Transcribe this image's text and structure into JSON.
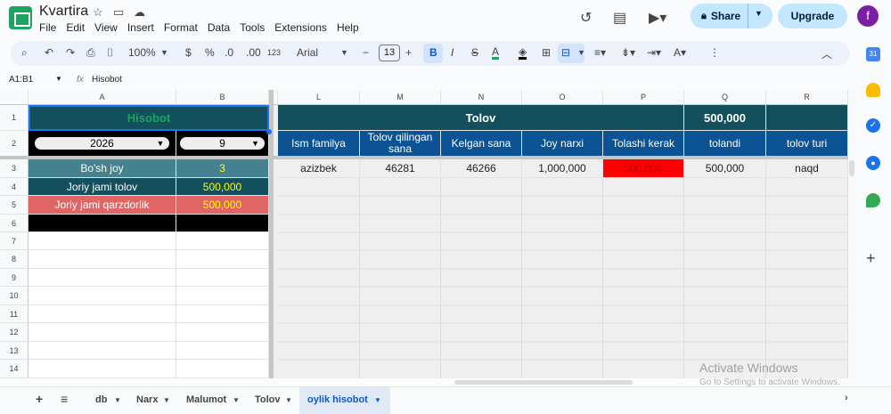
{
  "header": {
    "title": "Kvartira",
    "menus": [
      "File",
      "Edit",
      "View",
      "Insert",
      "Format",
      "Data",
      "Tools",
      "Extensions",
      "Help"
    ],
    "share_label": "Share",
    "upgrade_label": "Upgrade",
    "avatar_letter": "f"
  },
  "toolbar": {
    "zoom": "100%",
    "currency": "$",
    "percent": "%",
    "dec_decrease": ".0",
    "dec_increase": ".00",
    "number_format": "123",
    "font": "Arial",
    "font_size": "13",
    "bold": "B",
    "italic": "I",
    "strike": "S",
    "text_color": "A"
  },
  "formula_bar": {
    "cell_ref": "A1:B1",
    "fx": "fx",
    "content": "Hisobot"
  },
  "columns_left": [
    "A",
    "B"
  ],
  "columns_right": [
    "L",
    "M",
    "N",
    "O",
    "P",
    "Q",
    "R"
  ],
  "rows": [
    "1",
    "2",
    "3",
    "4",
    "5",
    "6",
    "7",
    "8",
    "9",
    "10",
    "11",
    "12",
    "13",
    "14"
  ],
  "left_table": {
    "title": "Hisobot",
    "year": "2026",
    "month": "9",
    "items": [
      {
        "label": "Bo'sh joy",
        "value": "3"
      },
      {
        "label": "Joriy jami tolov",
        "value": "500,000"
      },
      {
        "label": "Joriy jami qarzdorlik",
        "value": "500,000"
      }
    ]
  },
  "right_table": {
    "title": "Tolov",
    "total": "500,000",
    "headers": [
      "Ism familya",
      "Tolov qilingan sana",
      "Kelgan sana",
      "Joy narxi",
      "Tolashi kerak",
      "tolandi",
      "tolov turi"
    ],
    "row": [
      "azizbek",
      "46281",
      "46266",
      "1,000,000",
      "500,000",
      "500,000",
      "naqd"
    ]
  },
  "sheet_tabs": [
    "db",
    "Narx",
    "Malumot",
    "Tolov",
    "oylik hisobot"
  ],
  "active_tab": "oylik hisobot",
  "watermark": {
    "line1": "Activate Windows",
    "line2": "Go to Settings to activate Windows."
  },
  "colors": {
    "teal": "#134f5c",
    "blue": "#0b5394",
    "green": "#1ea362",
    "red": "#ff0000",
    "salmon": "#e06666",
    "yellow": "#ffff00"
  }
}
